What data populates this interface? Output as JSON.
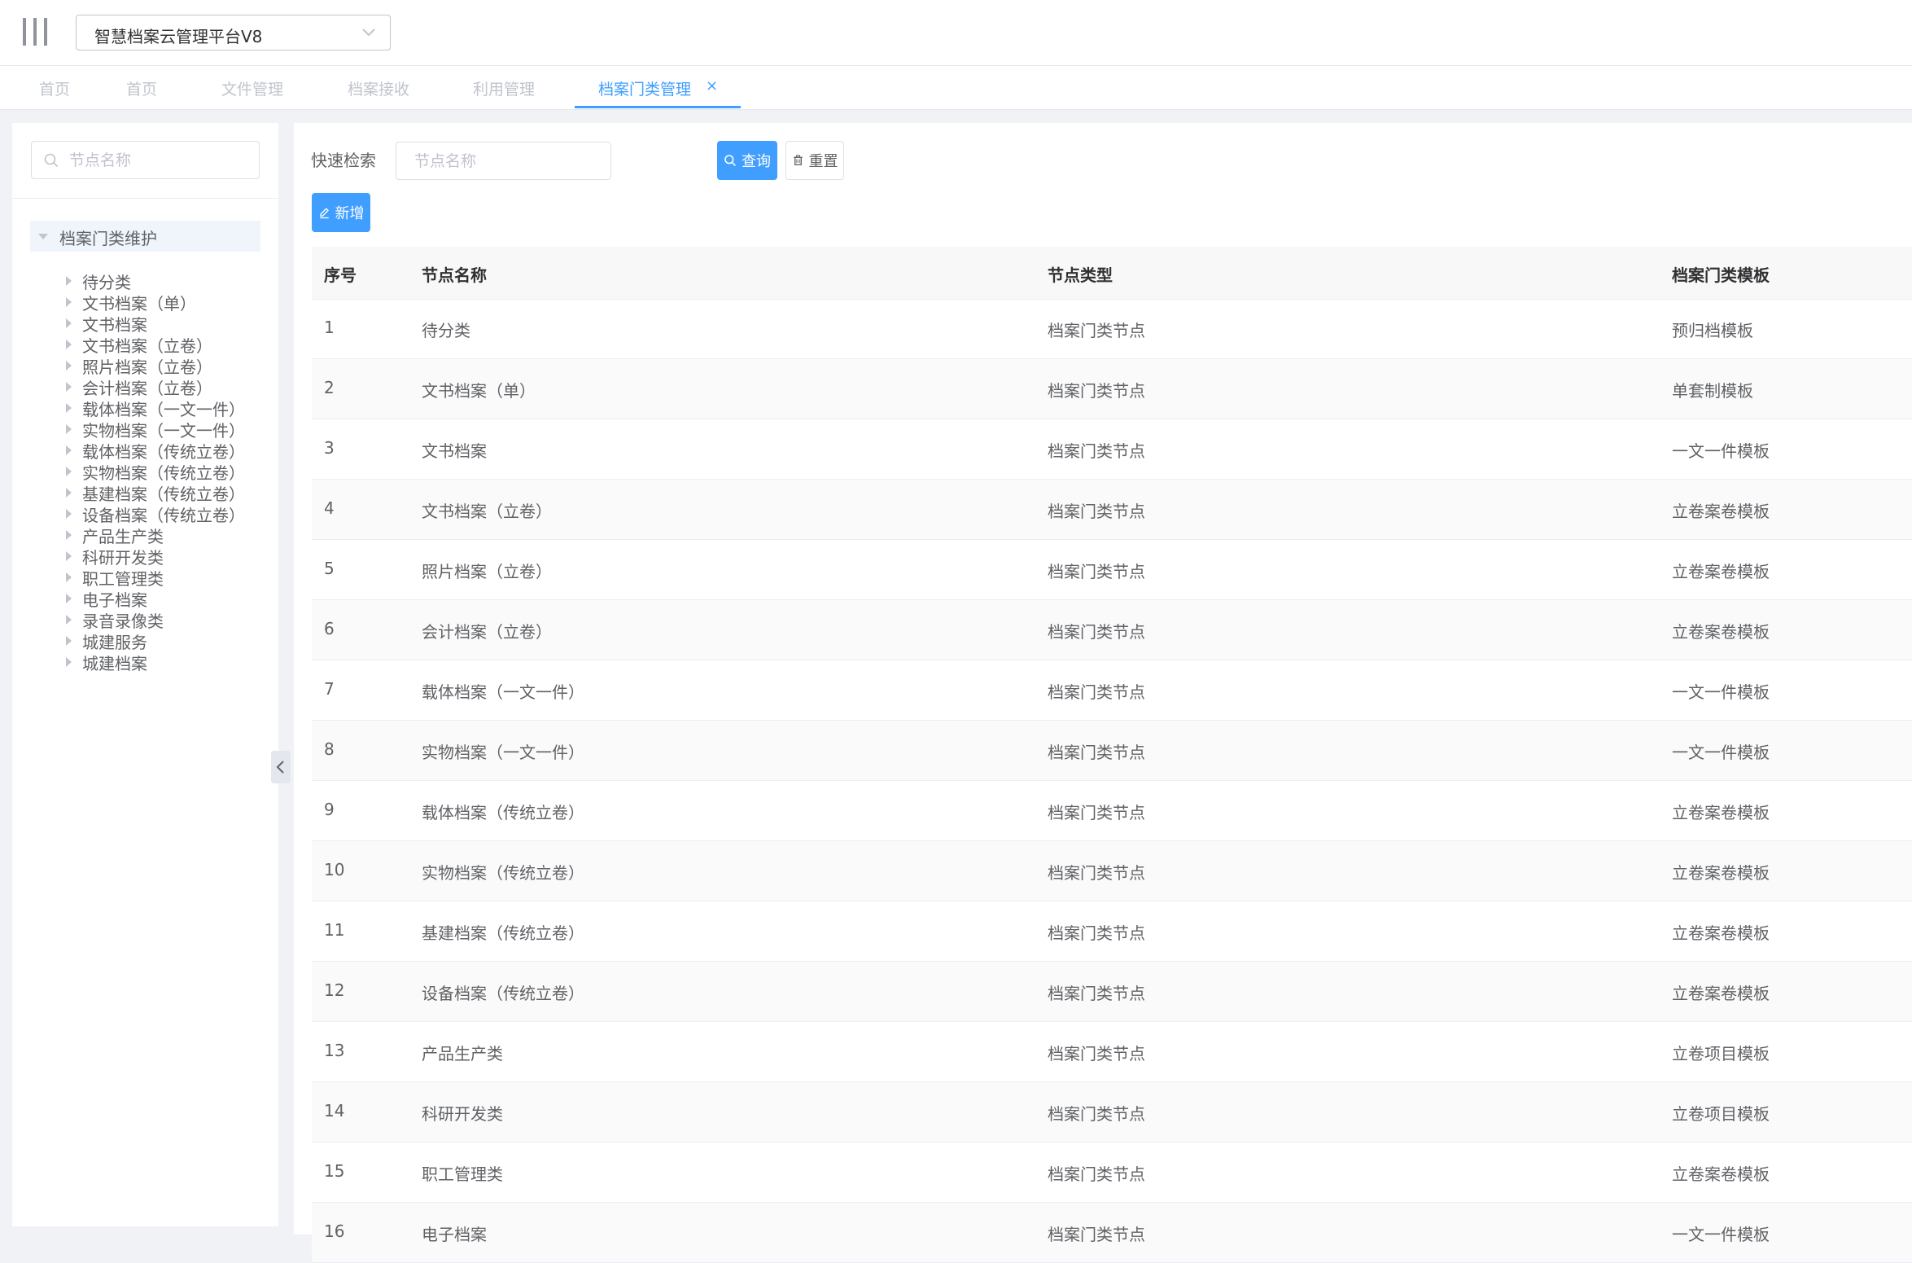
{
  "header": {
    "platform_name": "智慧档案云管理平台V8"
  },
  "tabs": [
    {
      "label": "首页"
    },
    {
      "label": "首页"
    },
    {
      "label": "文件管理"
    },
    {
      "label": "档案接收"
    },
    {
      "label": "利用管理"
    },
    {
      "label": "档案门类管理",
      "active": true,
      "close": "×"
    }
  ],
  "sidebar": {
    "search_placeholder": "节点名称",
    "root_label": "档案门类维护",
    "items": [
      {
        "label": "待分类"
      },
      {
        "label": "文书档案（单）"
      },
      {
        "label": "文书档案"
      },
      {
        "label": "文书档案（立卷）"
      },
      {
        "label": "照片档案（立卷）"
      },
      {
        "label": "会计档案（立卷）"
      },
      {
        "label": "载体档案（一文一件）"
      },
      {
        "label": "实物档案（一文一件）"
      },
      {
        "label": "载体档案（传统立卷）"
      },
      {
        "label": "实物档案（传统立卷）"
      },
      {
        "label": "基建档案（传统立卷）"
      },
      {
        "label": "设备档案（传统立卷）"
      },
      {
        "label": "产品生产类"
      },
      {
        "label": "科研开发类"
      },
      {
        "label": "职工管理类"
      },
      {
        "label": "电子档案"
      },
      {
        "label": "录音录像类"
      },
      {
        "label": "城建服务"
      },
      {
        "label": "城建档案"
      }
    ]
  },
  "search": {
    "label": "快速检索",
    "placeholder": "节点名称",
    "query_label": "查询",
    "reset_label": "重置",
    "add_label": "新增"
  },
  "table": {
    "headers": [
      "序号",
      "节点名称",
      "节点类型",
      "档案门类模板"
    ],
    "rows": [
      {
        "no": "1",
        "name": "待分类",
        "type": "档案门类节点",
        "template": "预归档模板"
      },
      {
        "no": "2",
        "name": "文书档案（单）",
        "type": "档案门类节点",
        "template": "单套制模板"
      },
      {
        "no": "3",
        "name": "文书档案",
        "type": "档案门类节点",
        "template": "一文一件模板"
      },
      {
        "no": "4",
        "name": "文书档案（立卷）",
        "type": "档案门类节点",
        "template": "立卷案卷模板"
      },
      {
        "no": "5",
        "name": "照片档案（立卷）",
        "type": "档案门类节点",
        "template": "立卷案卷模板"
      },
      {
        "no": "6",
        "name": "会计档案（立卷）",
        "type": "档案门类节点",
        "template": "立卷案卷模板"
      },
      {
        "no": "7",
        "name": "载体档案（一文一件）",
        "type": "档案门类节点",
        "template": "一文一件模板"
      },
      {
        "no": "8",
        "name": "实物档案（一文一件）",
        "type": "档案门类节点",
        "template": "一文一件模板"
      },
      {
        "no": "9",
        "name": "载体档案（传统立卷）",
        "type": "档案门类节点",
        "template": "立卷案卷模板"
      },
      {
        "no": "10",
        "name": "实物档案（传统立卷）",
        "type": "档案门类节点",
        "template": "立卷案卷模板"
      },
      {
        "no": "11",
        "name": "基建档案（传统立卷）",
        "type": "档案门类节点",
        "template": "立卷案卷模板"
      },
      {
        "no": "12",
        "name": "设备档案（传统立卷）",
        "type": "档案门类节点",
        "template": "立卷案卷模板"
      },
      {
        "no": "13",
        "name": "产品生产类",
        "type": "档案门类节点",
        "template": "立卷项目模板"
      },
      {
        "no": "14",
        "name": "科研开发类",
        "type": "档案门类节点",
        "template": "立卷项目模板"
      },
      {
        "no": "15",
        "name": "职工管理类",
        "type": "档案门类节点",
        "template": "立卷案卷模板"
      },
      {
        "no": "16",
        "name": "电子档案",
        "type": "档案门类节点",
        "template": "一文一件模板"
      }
    ]
  },
  "colors": {
    "primary": "#409eff",
    "text": "#606266",
    "placeholder": "#c0c4cc"
  }
}
